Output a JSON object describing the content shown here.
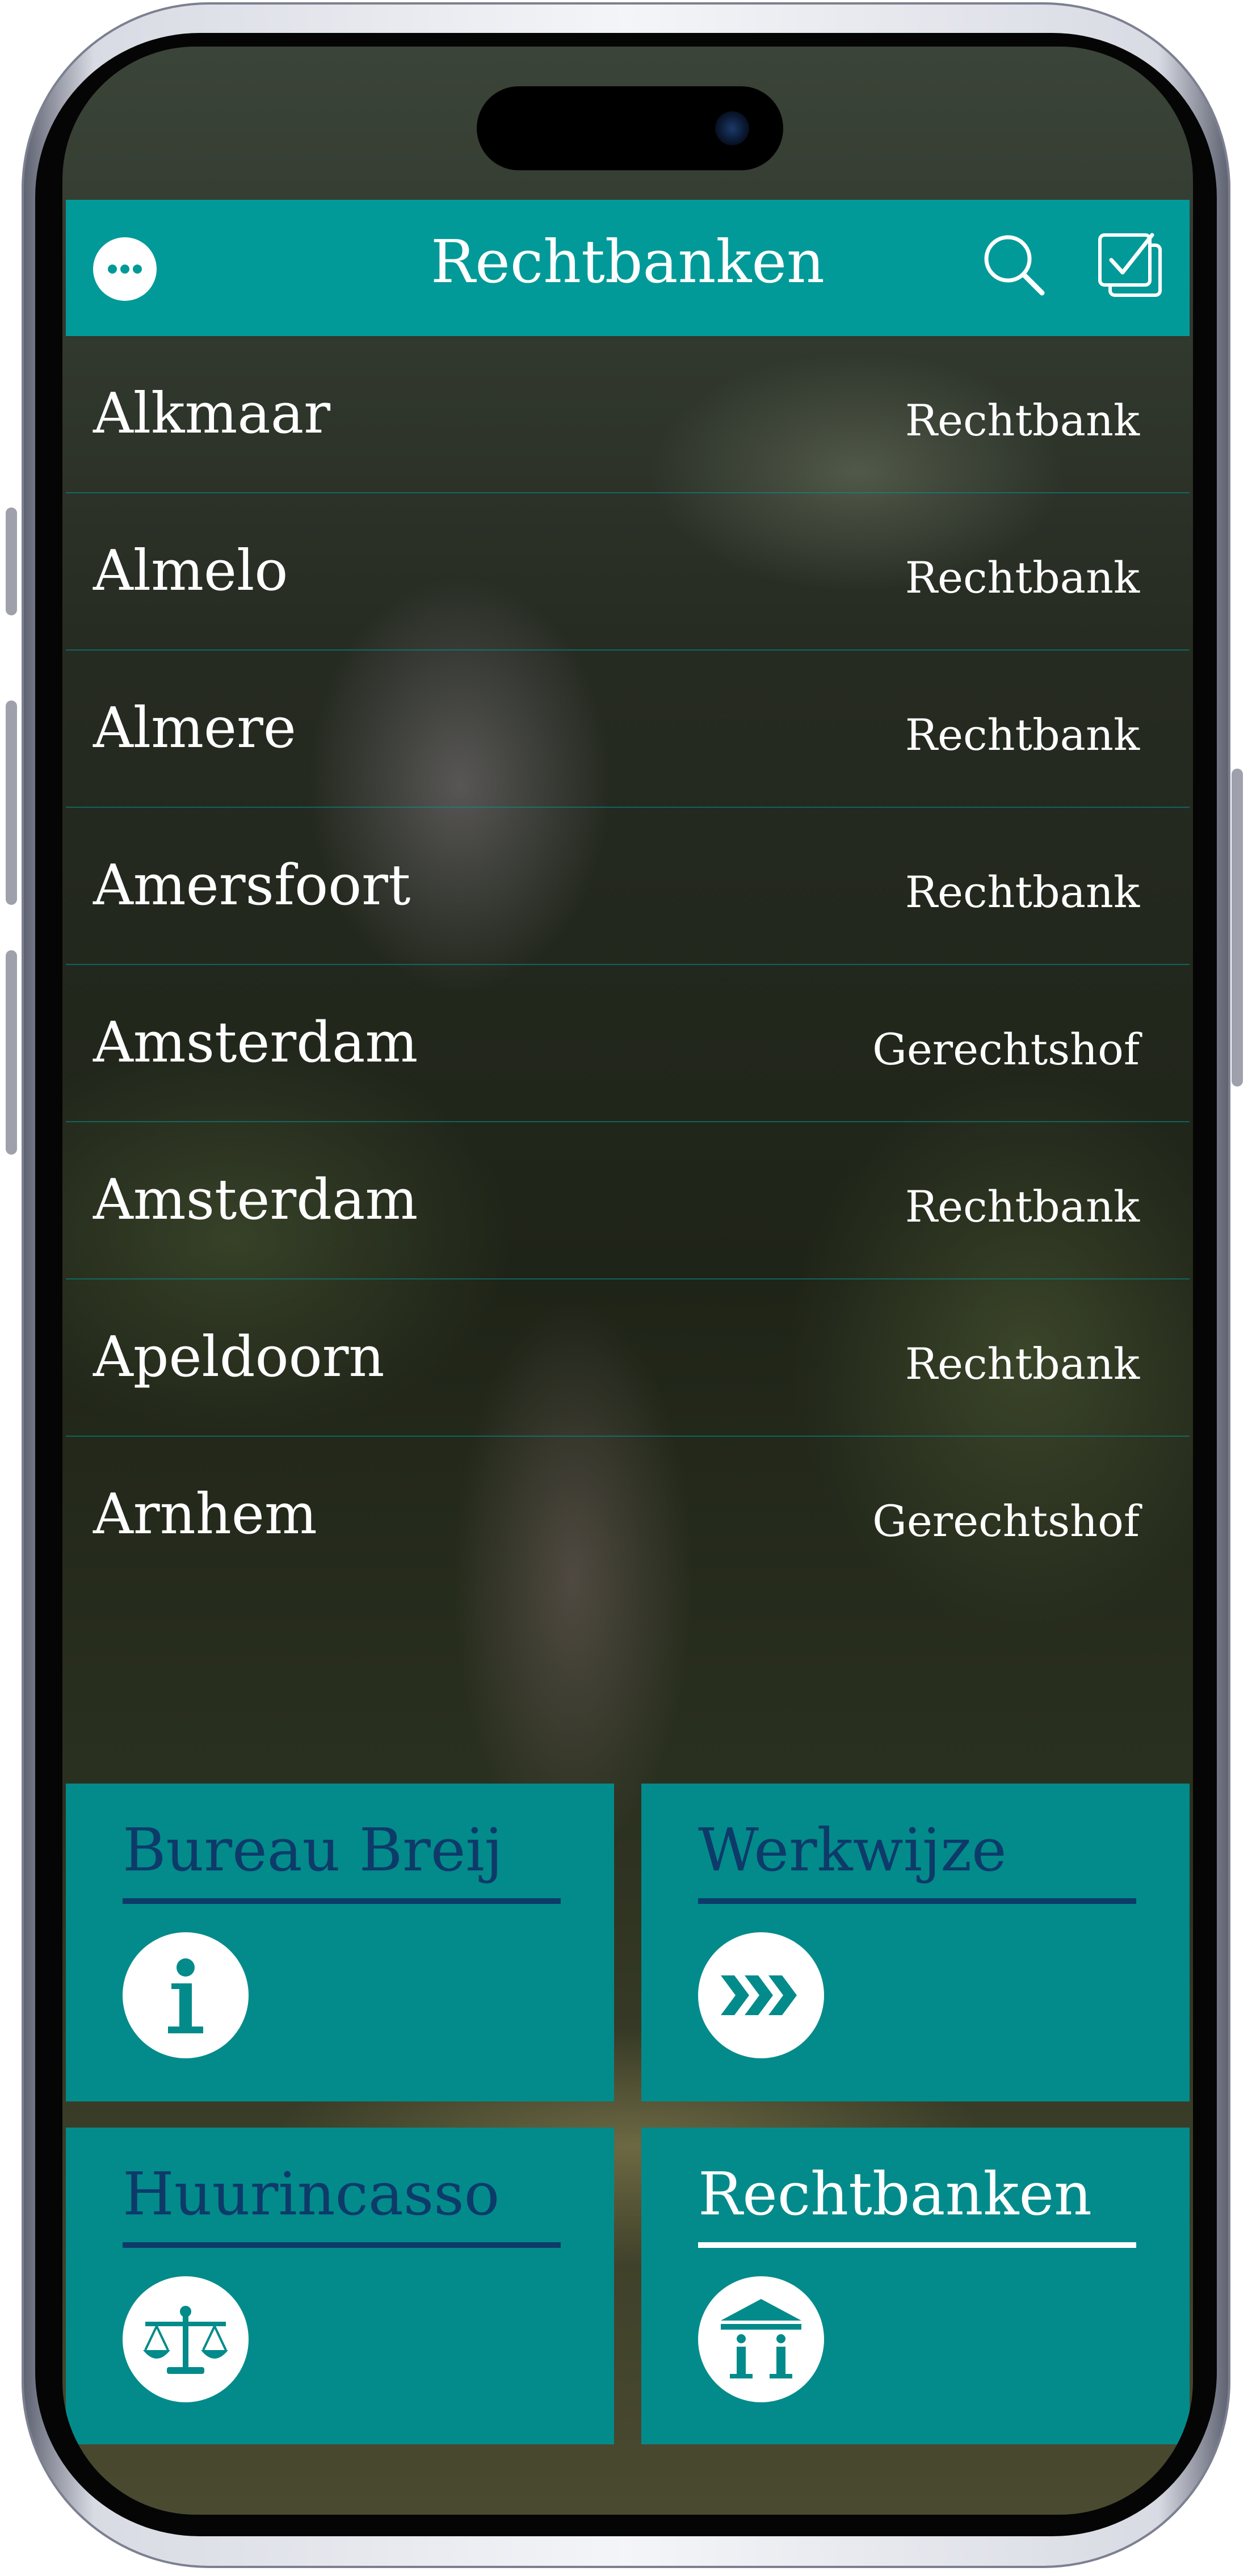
{
  "header": {
    "title": "Rechtbanken",
    "background": "#029a99",
    "icons": {
      "left": "more-icon",
      "search": "search-icon",
      "right": "checkbox-icon"
    }
  },
  "list": [
    {
      "name": "Alkmaar",
      "type": "Rechtbank"
    },
    {
      "name": "Almelo",
      "type": "Rechtbank"
    },
    {
      "name": "Almere",
      "type": "Rechtbank"
    },
    {
      "name": "Amersfoort",
      "type": "Rechtbank"
    },
    {
      "name": "Amsterdam",
      "type": "Gerechtshof"
    },
    {
      "name": "Amsterdam",
      "type": "Rechtbank"
    },
    {
      "name": "Apeldoorn",
      "type": "Rechtbank"
    },
    {
      "name": "Arnhem",
      "type": "Gerechtshof"
    }
  ],
  "tiles": [
    {
      "label": "Bureau Breij",
      "icon": "info-icon",
      "active": false
    },
    {
      "label": "Werkwijze",
      "icon": "chevrons-right-icon",
      "active": false
    },
    {
      "label": "Huurincasso",
      "icon": "scales-icon",
      "active": false
    },
    {
      "label": "Rechtbanken",
      "icon": "courthouse-icon",
      "active": true
    }
  ],
  "colors": {
    "tile": "#028b8a",
    "tile_text": "#0e3a6a",
    "active_text": "#ffffff"
  }
}
